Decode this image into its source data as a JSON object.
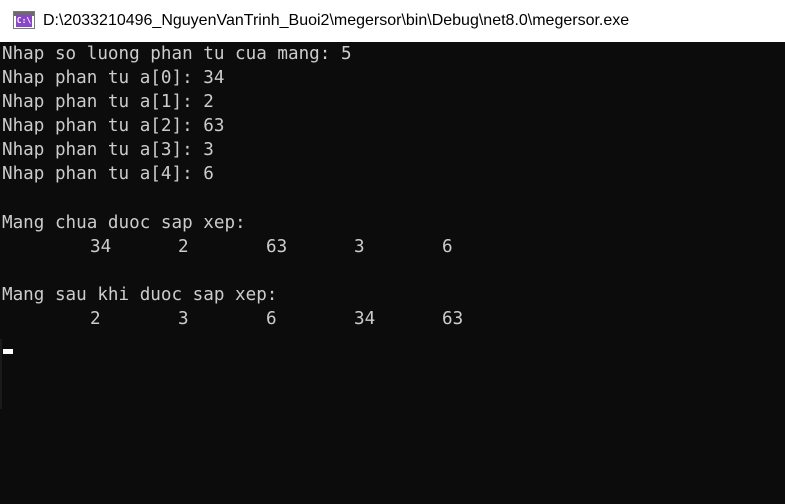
{
  "window": {
    "title": "D:\\2033210496_NguyenVanTrinh_Buoi2\\megersor\\bin\\Debug\\net8.0\\megersor.exe",
    "icon": "console-app-icon",
    "icon_text": "C:\\"
  },
  "colors": {
    "console_bg": "#0c0c0c",
    "console_fg": "#cccccc",
    "titlebar_bg": "#ffffff",
    "icon_accent": "#8a45c9"
  },
  "console": {
    "lines": [
      "Nhap so luong phan tu cua mang: 5",
      "Nhap phan tu a[0]: 34",
      "Nhap phan tu a[1]: 2",
      "Nhap phan tu a[2]: 63",
      "Nhap phan tu a[3]: 3",
      "Nhap phan tu a[4]: 6",
      "Mang chua duoc sap xep:",
      "Mang sau khi duoc sap xep:"
    ],
    "unsorted": [
      "34",
      "2",
      "63",
      "3",
      "6"
    ],
    "sorted": [
      "2",
      "3",
      "6",
      "34",
      "63"
    ]
  }
}
